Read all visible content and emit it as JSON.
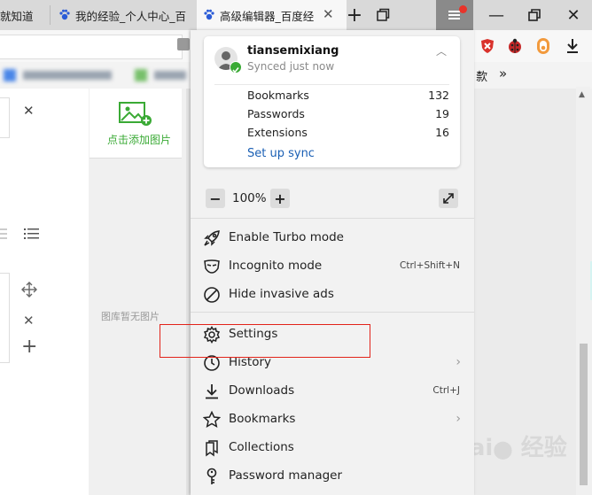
{
  "tabs": [
    {
      "title": "就知道",
      "active": false
    },
    {
      "title": "我的经验_个人中心_百",
      "active": false
    },
    {
      "title": "高级编辑器_百度经",
      "active": true
    }
  ],
  "left_panel": {
    "add_image_label": "点击添加图片",
    "empty_gallery_label": "图库暂无图片"
  },
  "bookmarks_bar": {
    "overflow_label": "歀",
    "more_label": "»"
  },
  "menu": {
    "sync": {
      "username": "tiansemixiang",
      "status": "Synced just now",
      "rows": [
        {
          "label": "Bookmarks",
          "count": "132"
        },
        {
          "label": "Passwords",
          "count": "19"
        },
        {
          "label": "Extensions",
          "count": "16"
        }
      ],
      "setup_label": "Set up sync"
    },
    "zoom": {
      "minus": "−",
      "value": "100%",
      "plus": "+"
    },
    "items": [
      {
        "label": "Enable Turbo mode",
        "icon": "rocket-icon",
        "shortcut": ""
      },
      {
        "label": "Incognito mode",
        "icon": "incognito-mask-icon",
        "shortcut": "Ctrl+Shift+N"
      },
      {
        "label": "Hide invasive ads",
        "icon": "block-icon",
        "shortcut": ""
      },
      {
        "label": "Settings",
        "icon": "gear-icon",
        "shortcut": ""
      },
      {
        "label": "History",
        "icon": "clock-icon",
        "shortcut": "",
        "submenu": true
      },
      {
        "label": "Downloads",
        "icon": "download-icon",
        "shortcut": "Ctrl+J"
      },
      {
        "label": "Bookmarks",
        "icon": "star-icon",
        "shortcut": "",
        "submenu": true
      },
      {
        "label": "Collections",
        "icon": "collections-icon",
        "shortcut": ""
      },
      {
        "label": "Password manager",
        "icon": "key-icon",
        "shortcut": ""
      }
    ]
  },
  "colors": {
    "highlight": "#e2231a",
    "accent": "#1a5fb4",
    "green": "#3aaa35"
  }
}
